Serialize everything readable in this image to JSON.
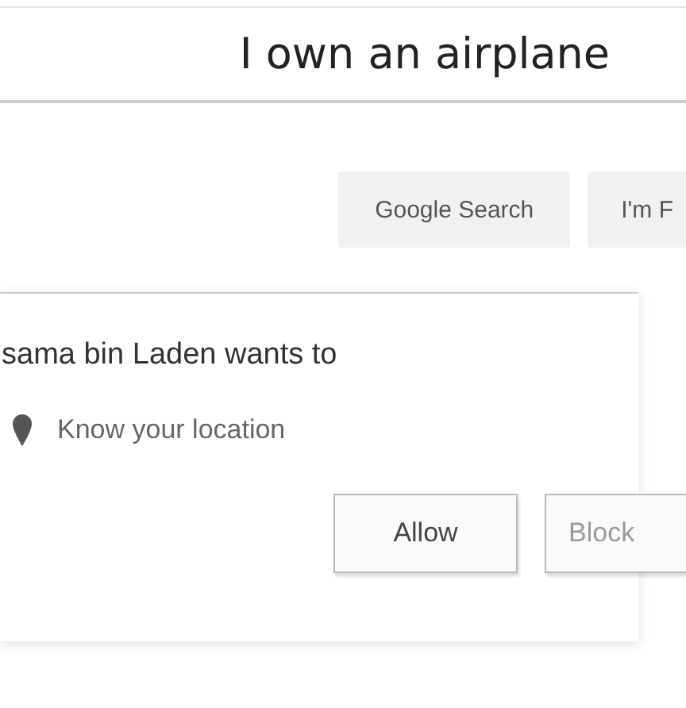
{
  "search": {
    "value": "I own an airplane"
  },
  "search_buttons": [
    "Google Search",
    "I'm F"
  ],
  "permission_popup": {
    "title": "sama bin Laden wants to",
    "request": "Know your location",
    "buttons": [
      "Allow",
      "Block"
    ]
  }
}
